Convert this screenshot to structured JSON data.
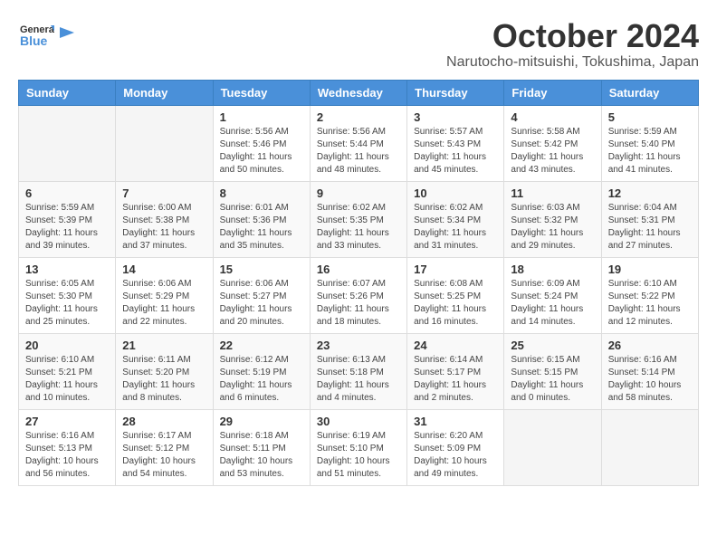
{
  "header": {
    "logo_general": "General",
    "logo_blue": "Blue",
    "title": "October 2024",
    "subtitle": "Narutocho-mitsuishi, Tokushima, Japan"
  },
  "weekdays": [
    "Sunday",
    "Monday",
    "Tuesday",
    "Wednesday",
    "Thursday",
    "Friday",
    "Saturday"
  ],
  "weeks": [
    [
      {
        "day": "",
        "info": ""
      },
      {
        "day": "",
        "info": ""
      },
      {
        "day": "1",
        "info": "Sunrise: 5:56 AM\nSunset: 5:46 PM\nDaylight: 11 hours and 50 minutes."
      },
      {
        "day": "2",
        "info": "Sunrise: 5:56 AM\nSunset: 5:44 PM\nDaylight: 11 hours and 48 minutes."
      },
      {
        "day": "3",
        "info": "Sunrise: 5:57 AM\nSunset: 5:43 PM\nDaylight: 11 hours and 45 minutes."
      },
      {
        "day": "4",
        "info": "Sunrise: 5:58 AM\nSunset: 5:42 PM\nDaylight: 11 hours and 43 minutes."
      },
      {
        "day": "5",
        "info": "Sunrise: 5:59 AM\nSunset: 5:40 PM\nDaylight: 11 hours and 41 minutes."
      }
    ],
    [
      {
        "day": "6",
        "info": "Sunrise: 5:59 AM\nSunset: 5:39 PM\nDaylight: 11 hours and 39 minutes."
      },
      {
        "day": "7",
        "info": "Sunrise: 6:00 AM\nSunset: 5:38 PM\nDaylight: 11 hours and 37 minutes."
      },
      {
        "day": "8",
        "info": "Sunrise: 6:01 AM\nSunset: 5:36 PM\nDaylight: 11 hours and 35 minutes."
      },
      {
        "day": "9",
        "info": "Sunrise: 6:02 AM\nSunset: 5:35 PM\nDaylight: 11 hours and 33 minutes."
      },
      {
        "day": "10",
        "info": "Sunrise: 6:02 AM\nSunset: 5:34 PM\nDaylight: 11 hours and 31 minutes."
      },
      {
        "day": "11",
        "info": "Sunrise: 6:03 AM\nSunset: 5:32 PM\nDaylight: 11 hours and 29 minutes."
      },
      {
        "day": "12",
        "info": "Sunrise: 6:04 AM\nSunset: 5:31 PM\nDaylight: 11 hours and 27 minutes."
      }
    ],
    [
      {
        "day": "13",
        "info": "Sunrise: 6:05 AM\nSunset: 5:30 PM\nDaylight: 11 hours and 25 minutes."
      },
      {
        "day": "14",
        "info": "Sunrise: 6:06 AM\nSunset: 5:29 PM\nDaylight: 11 hours and 22 minutes."
      },
      {
        "day": "15",
        "info": "Sunrise: 6:06 AM\nSunset: 5:27 PM\nDaylight: 11 hours and 20 minutes."
      },
      {
        "day": "16",
        "info": "Sunrise: 6:07 AM\nSunset: 5:26 PM\nDaylight: 11 hours and 18 minutes."
      },
      {
        "day": "17",
        "info": "Sunrise: 6:08 AM\nSunset: 5:25 PM\nDaylight: 11 hours and 16 minutes."
      },
      {
        "day": "18",
        "info": "Sunrise: 6:09 AM\nSunset: 5:24 PM\nDaylight: 11 hours and 14 minutes."
      },
      {
        "day": "19",
        "info": "Sunrise: 6:10 AM\nSunset: 5:22 PM\nDaylight: 11 hours and 12 minutes."
      }
    ],
    [
      {
        "day": "20",
        "info": "Sunrise: 6:10 AM\nSunset: 5:21 PM\nDaylight: 11 hours and 10 minutes."
      },
      {
        "day": "21",
        "info": "Sunrise: 6:11 AM\nSunset: 5:20 PM\nDaylight: 11 hours and 8 minutes."
      },
      {
        "day": "22",
        "info": "Sunrise: 6:12 AM\nSunset: 5:19 PM\nDaylight: 11 hours and 6 minutes."
      },
      {
        "day": "23",
        "info": "Sunrise: 6:13 AM\nSunset: 5:18 PM\nDaylight: 11 hours and 4 minutes."
      },
      {
        "day": "24",
        "info": "Sunrise: 6:14 AM\nSunset: 5:17 PM\nDaylight: 11 hours and 2 minutes."
      },
      {
        "day": "25",
        "info": "Sunrise: 6:15 AM\nSunset: 5:15 PM\nDaylight: 11 hours and 0 minutes."
      },
      {
        "day": "26",
        "info": "Sunrise: 6:16 AM\nSunset: 5:14 PM\nDaylight: 10 hours and 58 minutes."
      }
    ],
    [
      {
        "day": "27",
        "info": "Sunrise: 6:16 AM\nSunset: 5:13 PM\nDaylight: 10 hours and 56 minutes."
      },
      {
        "day": "28",
        "info": "Sunrise: 6:17 AM\nSunset: 5:12 PM\nDaylight: 10 hours and 54 minutes."
      },
      {
        "day": "29",
        "info": "Sunrise: 6:18 AM\nSunset: 5:11 PM\nDaylight: 10 hours and 53 minutes."
      },
      {
        "day": "30",
        "info": "Sunrise: 6:19 AM\nSunset: 5:10 PM\nDaylight: 10 hours and 51 minutes."
      },
      {
        "day": "31",
        "info": "Sunrise: 6:20 AM\nSunset: 5:09 PM\nDaylight: 10 hours and 49 minutes."
      },
      {
        "day": "",
        "info": ""
      },
      {
        "day": "",
        "info": ""
      }
    ]
  ]
}
